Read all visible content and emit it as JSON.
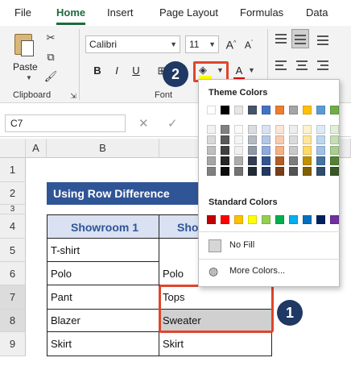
{
  "ribbon_tabs": [
    "File",
    "Home",
    "Insert",
    "Page Layout",
    "Formulas",
    "Data"
  ],
  "clipboard": {
    "paste_label": "Paste",
    "group_label": "Clipboard"
  },
  "font": {
    "name": "Calibri",
    "size": "11",
    "group_label": "Font"
  },
  "name_box": "C7",
  "columns": [
    "A",
    "B"
  ],
  "rows": [
    "1",
    "2",
    "3",
    "4",
    "5",
    "6",
    "7",
    "8",
    "9"
  ],
  "sheet": {
    "title": "Using Row Difference",
    "header_1": "Showroom 1",
    "header_2_visible": "Sho",
    "col1": [
      "T-shirt",
      "Polo",
      "Pant",
      "Blazer",
      "Skirt"
    ],
    "col2": [
      "Polo",
      "Tops",
      "Sweater",
      "Skirt"
    ]
  },
  "color_menu": {
    "theme_title": "Theme Colors",
    "standard_title": "Standard Colors",
    "no_fill": "No Fill",
    "more_colors": "More Colors...",
    "theme_top": [
      "#ffffff",
      "#000000",
      "#e7e6e6",
      "#44546a",
      "#4472c4",
      "#ed7d31",
      "#a5a5a5",
      "#ffc000",
      "#5b9bd5",
      "#70ad47"
    ],
    "standard": [
      "#c00000",
      "#ff0000",
      "#ffc000",
      "#ffff00",
      "#92d050",
      "#00b050",
      "#00b0f0",
      "#0070c0",
      "#002060",
      "#7030a0"
    ]
  },
  "callouts": [
    "2",
    "1"
  ],
  "colors": {
    "accent": "#1e6b39",
    "header_fill": "#2f5597",
    "callout_red": "#e0452b",
    "callout_circle": "#1f3864"
  }
}
